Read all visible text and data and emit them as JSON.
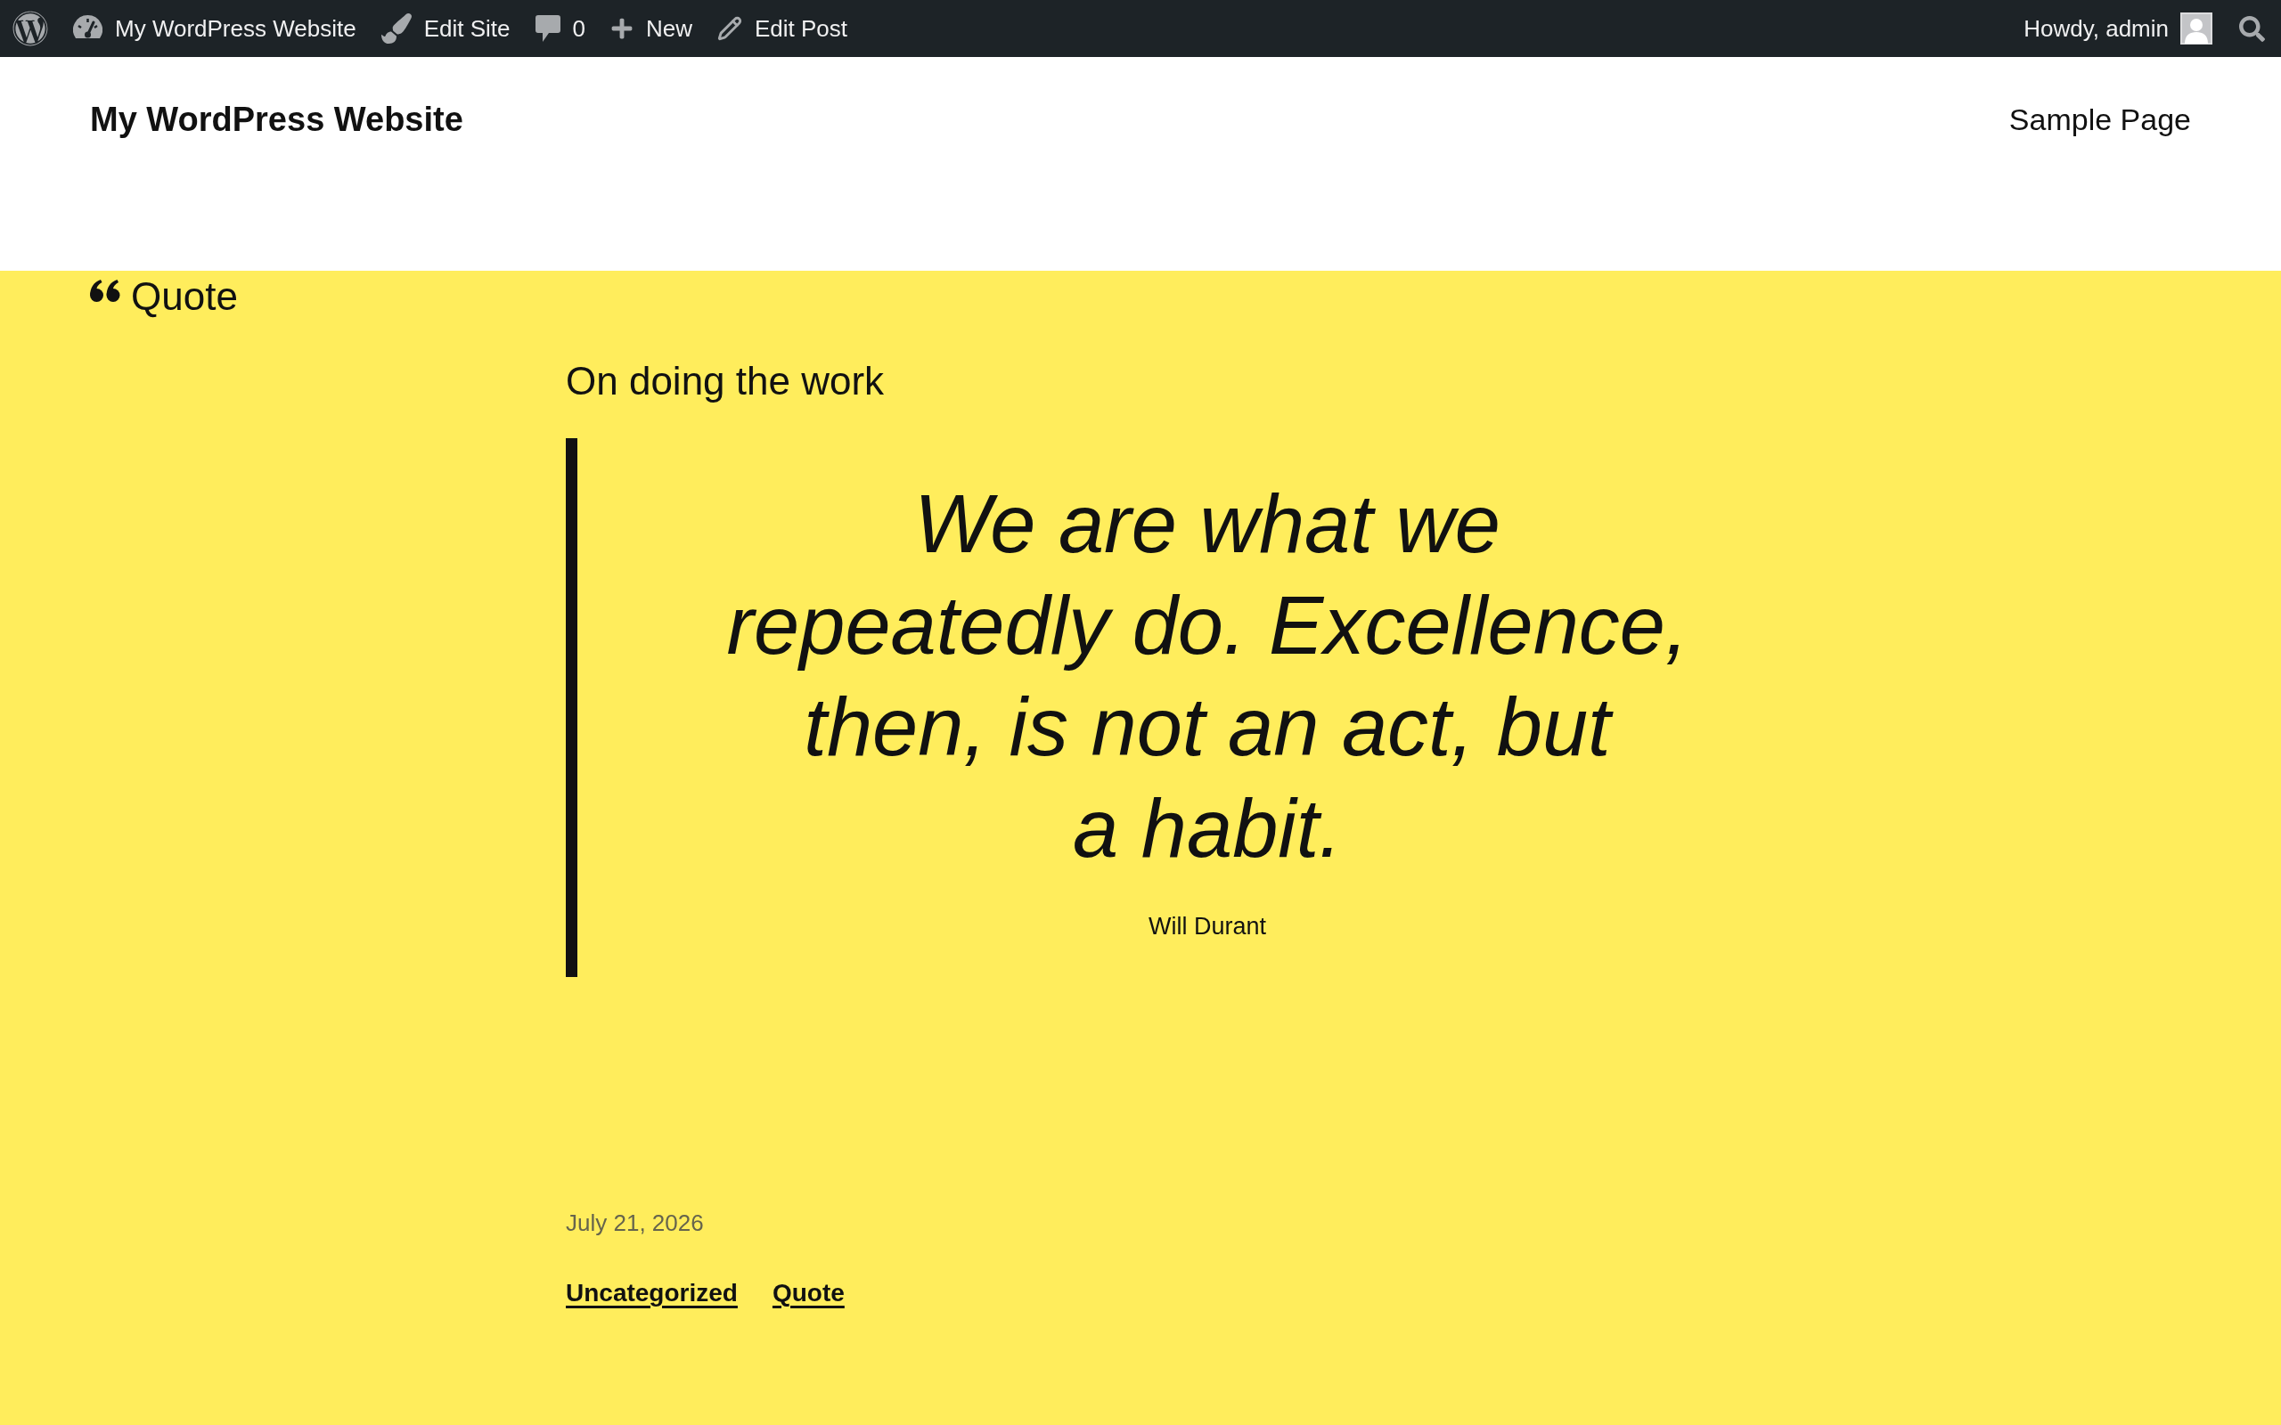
{
  "admin_bar": {
    "items": [
      {
        "kind": "site",
        "label": "My WordPress Website"
      },
      {
        "kind": "edit_site",
        "label": "Edit Site"
      },
      {
        "kind": "comments",
        "label": "0"
      },
      {
        "kind": "new",
        "label": "New"
      },
      {
        "kind": "edit_post",
        "label": "Edit Post"
      }
    ],
    "account": {
      "label": "Howdy, admin"
    }
  },
  "site_header": {
    "title": "My WordPress Website",
    "nav": [
      {
        "label": "Sample Page"
      }
    ]
  },
  "post": {
    "format_label": "Quote",
    "title": "On doing the work",
    "quote": {
      "text": "We are what we repeatedly do. Excellence, then, is not an act, but a habit.",
      "citation": "Will Durant"
    },
    "date": "July 21, 2026",
    "tags": [
      {
        "label": "Uncategorized"
      },
      {
        "label": "Quote"
      }
    ]
  }
}
